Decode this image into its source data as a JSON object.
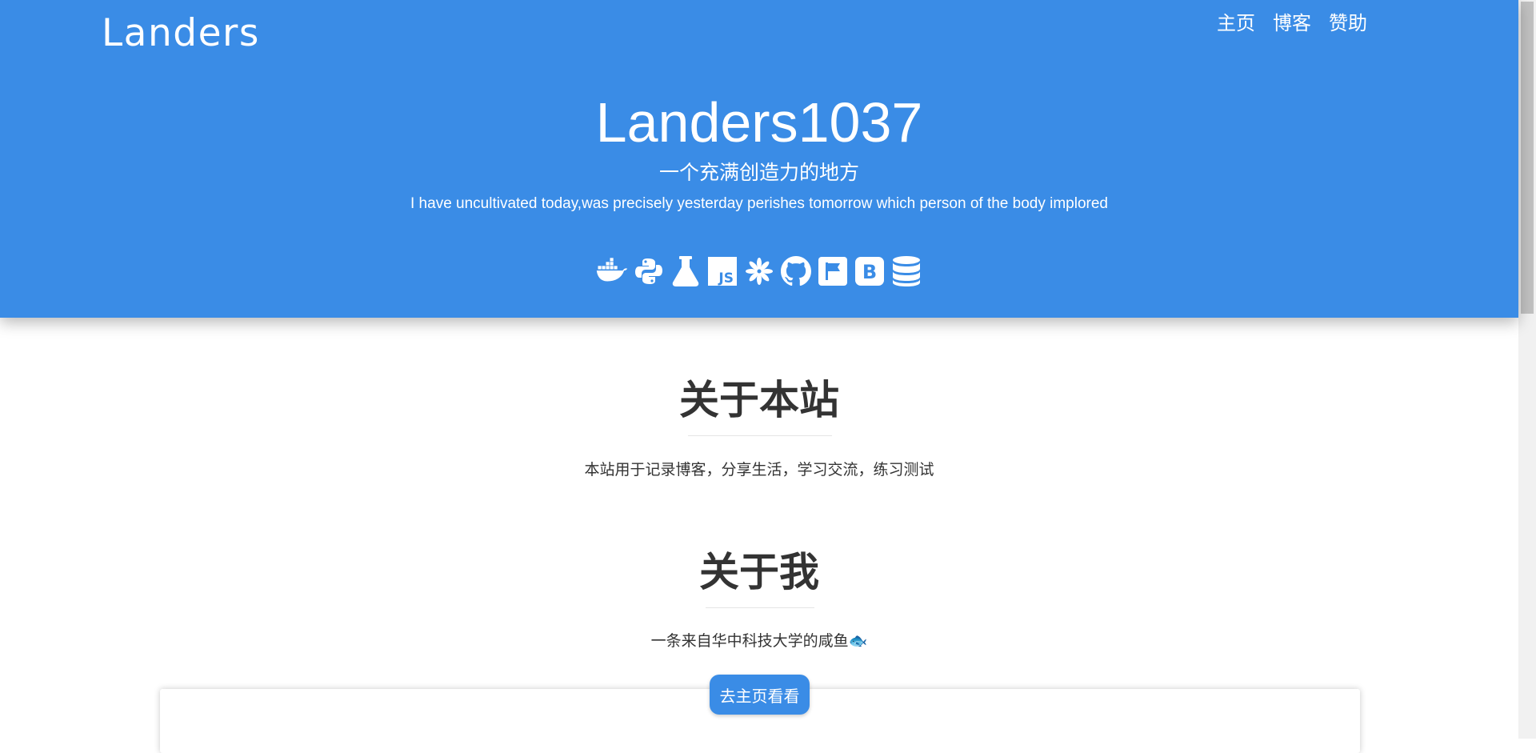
{
  "header": {
    "logo": "Landers",
    "nav": [
      "主页",
      "博客",
      "赞助"
    ]
  },
  "hero": {
    "title": "Landers1037",
    "subtitle": "一个充满创造力的地方",
    "tagline": "I have uncultivated today,was precisely yesterday perishes tomorrow which person of the body implored",
    "icons": [
      "docker-icon",
      "python-icon",
      "flask-icon",
      "javascript-icon",
      "apache-icon",
      "github-icon",
      "flag-icon",
      "bootstrap-icon",
      "database-icon"
    ]
  },
  "about_site": {
    "heading": "关于本站",
    "text": "本站用于记录博客，分享生活，学习交流，练习测试"
  },
  "about_me": {
    "heading": "关于我",
    "text": "一条来自华中科技大学的咸鱼🐟"
  },
  "cta": {
    "label": "去主页看看"
  },
  "colors": {
    "primary": "#3a8ce6",
    "text": "#333333",
    "background": "#ffffff"
  }
}
